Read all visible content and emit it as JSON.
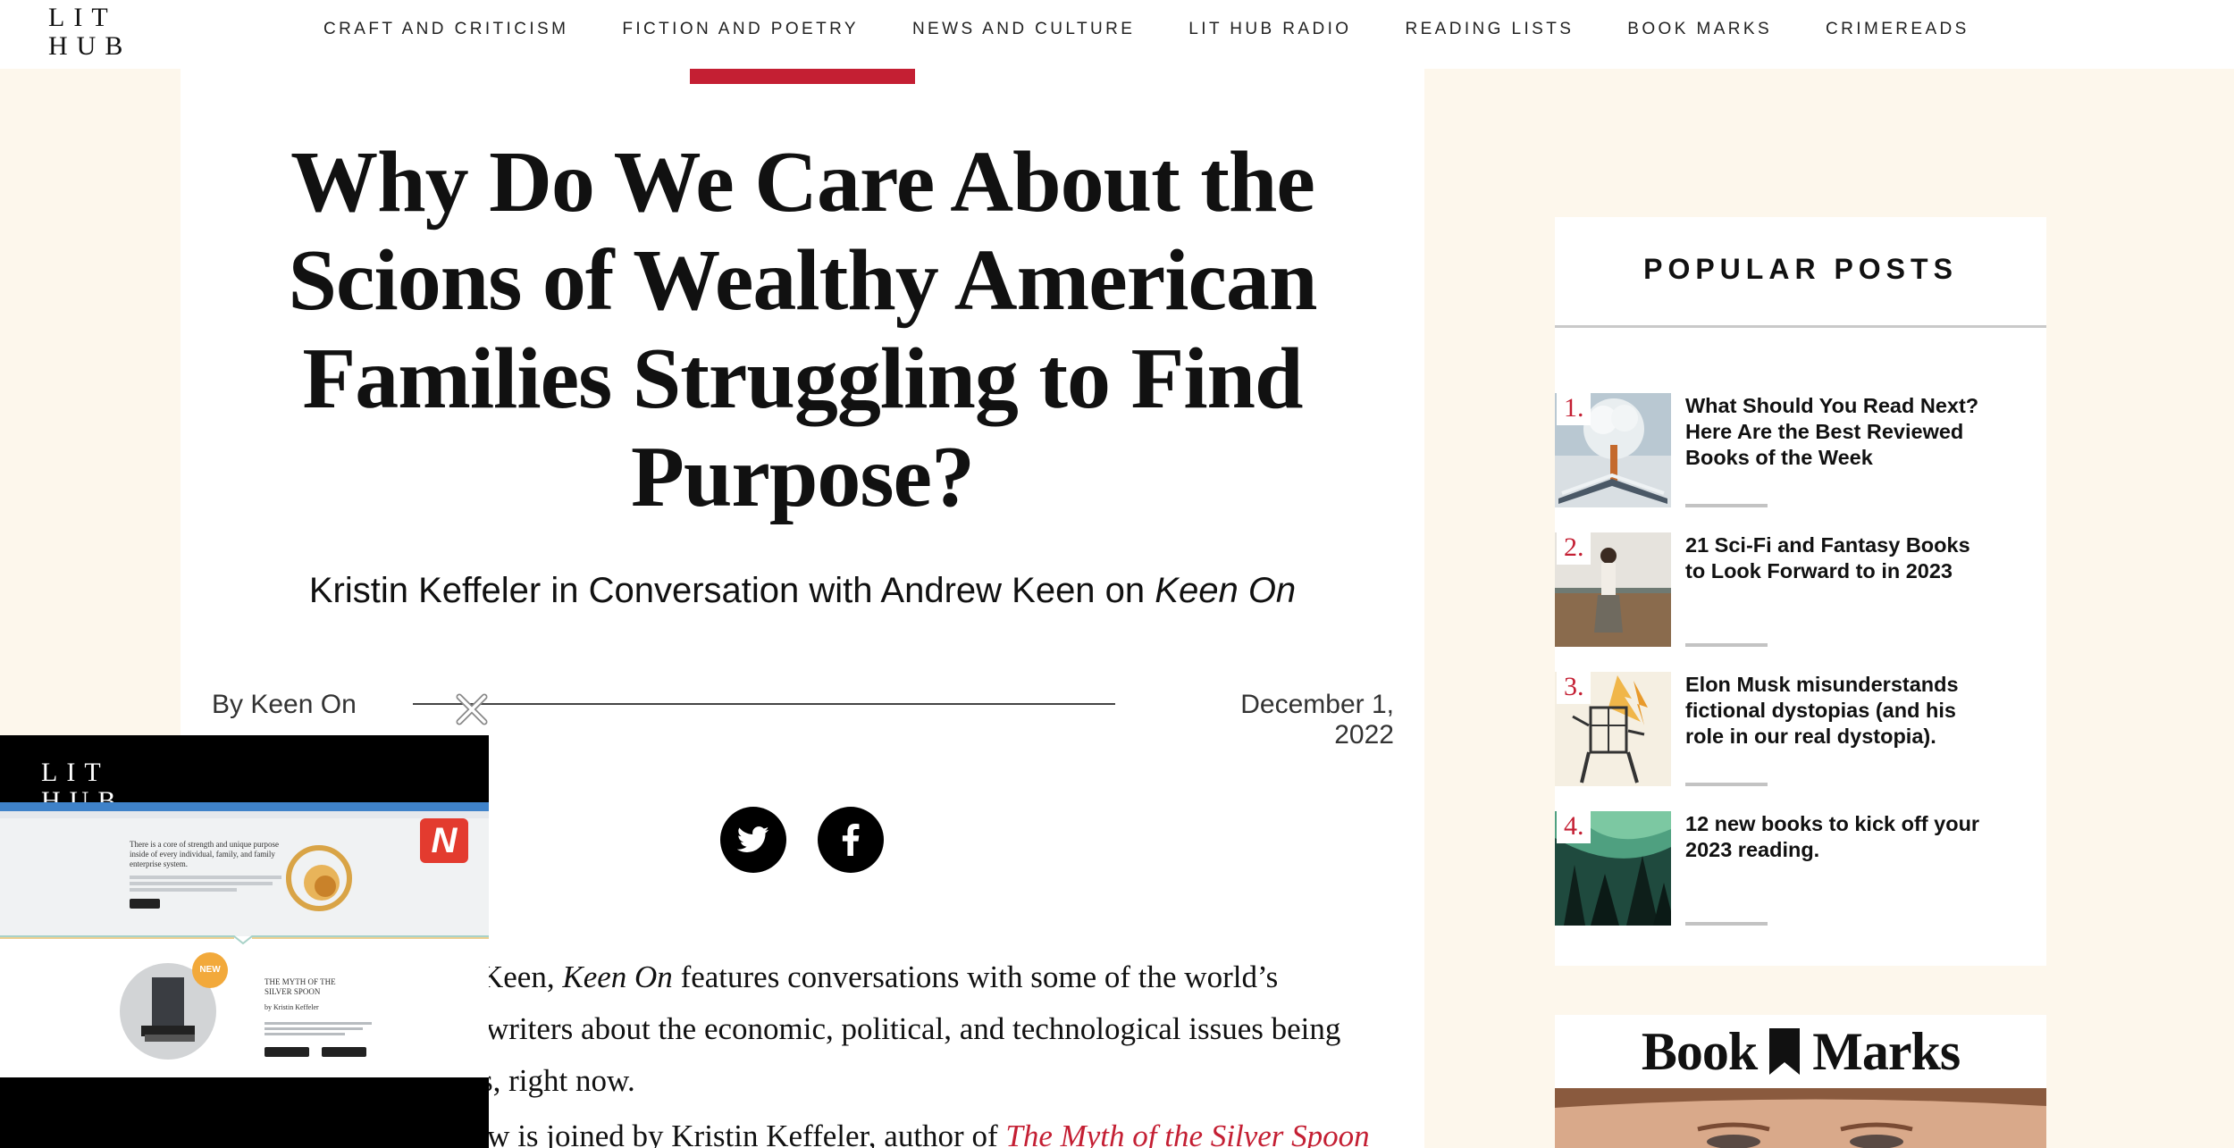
{
  "site": {
    "logo_line1": "LIT",
    "logo_line2": "HUB"
  },
  "nav": {
    "items": [
      "CRAFT AND CRITICISM",
      "FICTION AND POETRY",
      "NEWS AND CULTURE",
      "LIT HUB RADIO",
      "READING LISTS",
      "BOOK MARKS",
      "CRIMEREADS"
    ]
  },
  "article": {
    "title": "Why Do We Care About the Scions of Wealthy American Families Struggling to Find Purpose?",
    "subtitle_pre": "Kristin Keffeler in Conversation with Andrew Keen on ",
    "subtitle_show": "Keen On",
    "byline": "By Keen On",
    "date": "December 1, 2022",
    "share": [
      "twitter-icon",
      "facebook-icon"
    ],
    "body_line1_pre": "Keen, ",
    "body_line1_em": "Keen On",
    "body_line1_post": " features conversations with some of the world’s",
    "body_line2": "writers about the economic, political, and technological issues being",
    "body_line3": "s, right now.",
    "body_line4_pre": "In this episode, Andrew is joined by Kristin Keffeler, author of ",
    "body_line4_link": "The Myth of the Silver Spoon"
  },
  "sidebar": {
    "popular_title": "POPULAR POSTS",
    "posts": [
      {
        "num": "1.",
        "title": "What Should You Read Next? Here Are the Best Reviewed Books of the Week"
      },
      {
        "num": "2.",
        "title": "21 Sci-Fi and Fantasy Books to Look Forward to in 2023"
      },
      {
        "num": "3.",
        "title": "Elon Musk misunderstands fictional dystopias (and his role in our real dystopia)."
      },
      {
        "num": "4.",
        "title": "12 new books to kick off your 2023 reading."
      }
    ],
    "bookmarks_left": "Book",
    "bookmarks_right": "Marks"
  },
  "video": {
    "logo_line1": "LIT",
    "logo_line2": "HUB",
    "slide_heading": "There is a core of strength and unique purpose inside of every individual, family, and family enterprise system.",
    "book_title": "THE MYTH OF THE SILVER SPOON",
    "book_author": "by Kristin Keffeler",
    "badge": "NEW",
    "brand_letter": "N",
    "colors": {
      "accent_red": "#c41f33",
      "badge_orange": "#f2a93b"
    }
  },
  "colors": {
    "accent": "#c41f33",
    "page_bg": "#fdf7ec"
  }
}
